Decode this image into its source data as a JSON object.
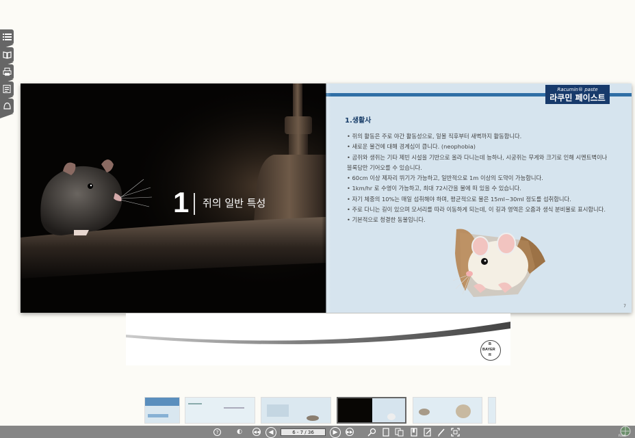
{
  "left_page": {
    "chapter_number": "1",
    "chapter_title": "쥐의 일반 특성"
  },
  "right_page": {
    "brand_small": "Racumin® paste",
    "brand_big": "라쿠민 페이스트",
    "section_title": "1.생활사",
    "bullets": [
      "• 쥐의 활동은 주로 야간 활동성으로, 일몰 직후부터 새벽까지 활동합니다.",
      "• 새로운 물건에 대해 경계심이 큽니다. (neophobia)",
      "• 곰쥐와 생쥐는 기타 제빈 시설을 기반으로 올라 다니는데 능하나, 시궁쥐는 무게와 크기로 인해 시멘트벽이나",
      "   블록담만 기어오를 수 있습니다.",
      "• 60cm 이상 제자리 뛰기가 가능하고, 일반적으로 1m 이상의 도약이 가능합니다.",
      "• 1km/hr 로 수영이 가능하고, 최대 72시간을 물에 떠 있을 수 있습니다.",
      "• 자기 체중의 10%는 매일 섭취해야 하며, 평균적으로 물은 15ml~30ml 정도를 섭취합니다.",
      "• 주로 다니는 길이 있으며 모서리를 따라 이동하게 되는데, 이 길과 영역은 오줌과 생식 분비물로 표시합니다.",
      "• 기본적으로 청결한 동물입니다."
    ],
    "page_number": "7"
  },
  "logo": {
    "top": "B",
    "middle": "BAYER",
    "bottom": "R"
  },
  "toolbar": {
    "page_indicator": "6 - 7 / 36",
    "corner_logo": "Flash"
  },
  "side_tools": [
    "list-icon",
    "book-icon",
    "print-icon",
    "document-icon",
    "bell-icon"
  ],
  "colors": {
    "toolbar": "#868686",
    "right_page_bg": "#d6e4ee",
    "brand_navy": "#173a6b",
    "accent_blue": "#2f6fa6"
  }
}
